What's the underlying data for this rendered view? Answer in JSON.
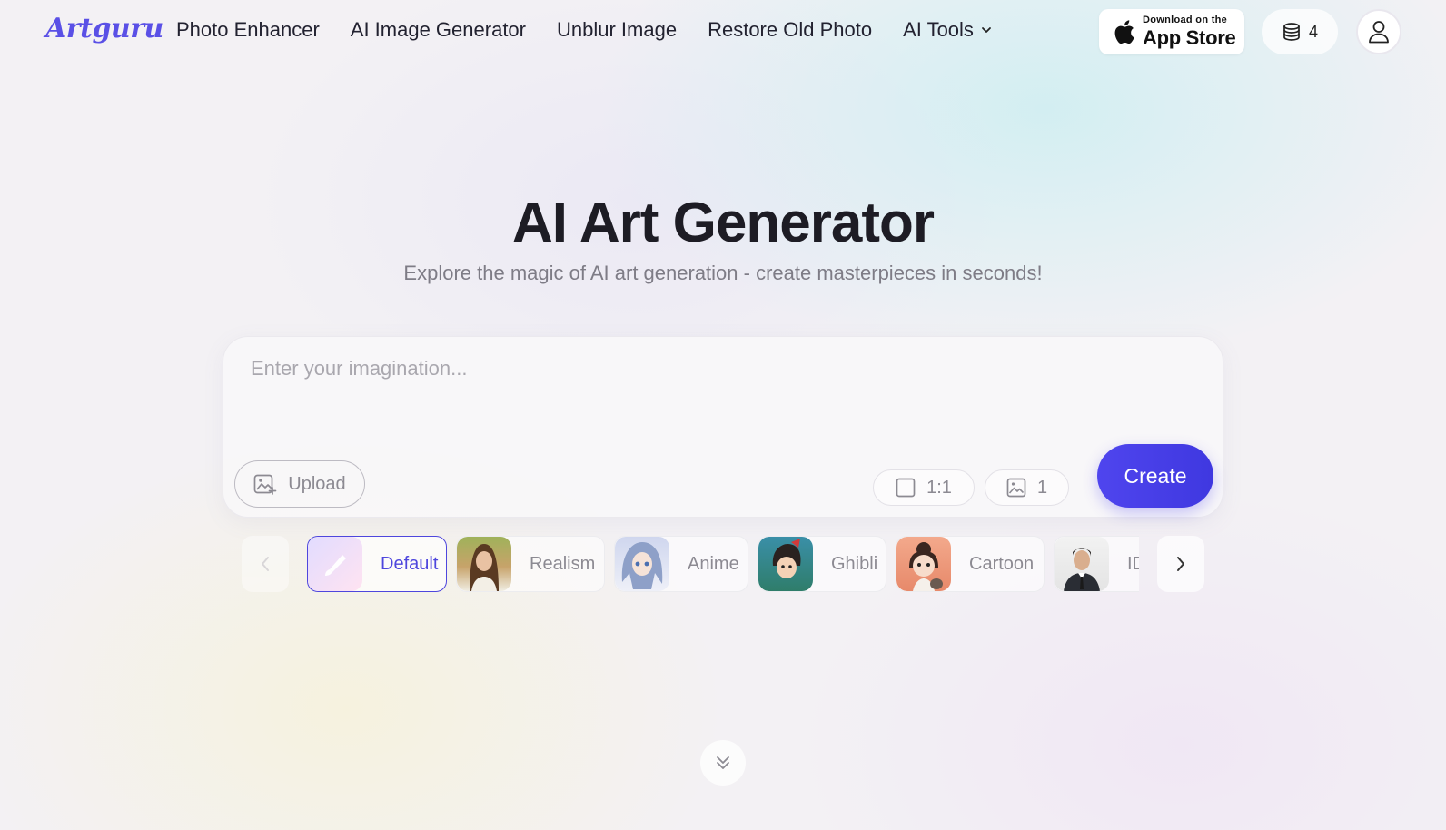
{
  "header": {
    "logo": "Artguru",
    "nav": [
      "Photo Enhancer",
      "AI Image Generator",
      "Unblur Image",
      "Restore Old Photo",
      "AI Tools"
    ],
    "appstore_small": "Download on the",
    "appstore_big": "App Store",
    "credits": "4"
  },
  "hero": {
    "title": "AI Art Generator",
    "subtitle": "Explore the magic of AI art generation - create masterpieces in seconds!"
  },
  "prompt": {
    "placeholder": "Enter your imagination...",
    "value": "",
    "upload_label": "Upload",
    "ratio": "1:1",
    "count": "1",
    "create_label": "Create"
  },
  "styles": {
    "selected": "Default",
    "items": [
      "Default",
      "Realism",
      "Anime",
      "Ghibli",
      "Cartoon",
      "ID"
    ]
  },
  "colors": {
    "accent": "#4f45ee",
    "logo": "#5a50e6"
  }
}
